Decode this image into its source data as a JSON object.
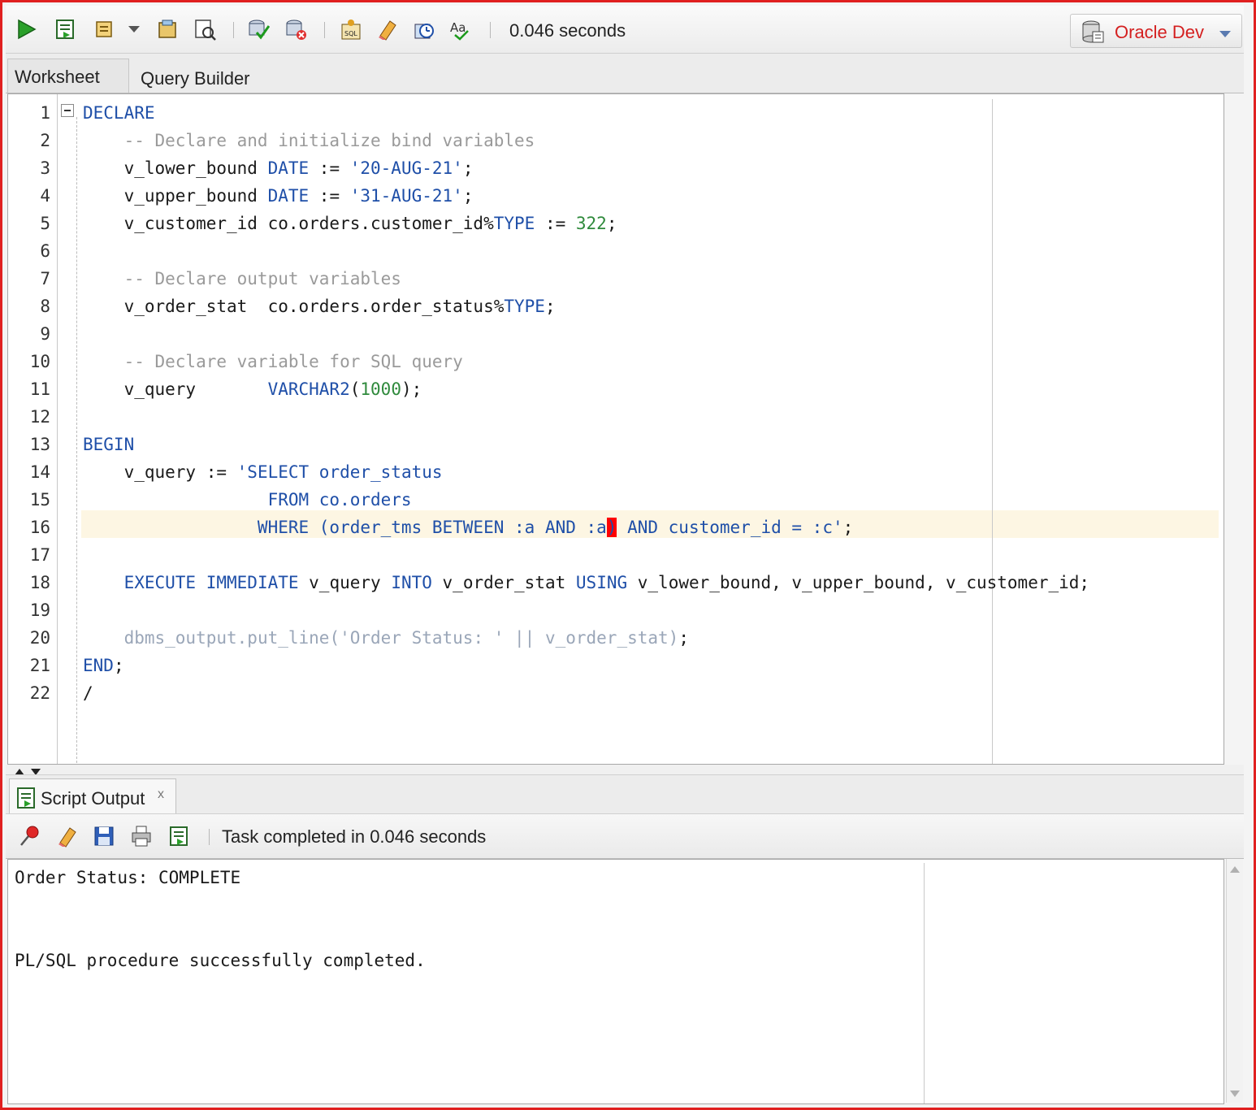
{
  "toolbar": {
    "icons": [
      "run-statement-icon",
      "run-script-icon",
      "commit-icon",
      "dropdown-arrow-icon",
      "autotrace-icon",
      "explain-plan-icon",
      "commit-changes-icon",
      "rollback-icon",
      "sql-tuning-icon",
      "clear-icon",
      "history-icon",
      "format-case-icon"
    ],
    "elapsed": "0.046 seconds",
    "connection": "Oracle Dev"
  },
  "tabs": {
    "worksheet": "Worksheet",
    "query_builder": "Query Builder"
  },
  "editor": {
    "line_numbers": [
      "1",
      "2",
      "3",
      "4",
      "5",
      "6",
      "7",
      "8",
      "9",
      "10",
      "11",
      "12",
      "13",
      "14",
      "15",
      "16",
      "17",
      "18",
      "19",
      "20",
      "21",
      "22"
    ],
    "lines": [
      [
        {
          "t": "DECLARE",
          "c": "kw"
        }
      ],
      [
        {
          "t": "    -- Declare and initialize bind variables",
          "c": "cm"
        }
      ],
      [
        {
          "t": "    v_lower_bound "
        },
        {
          "t": "DATE",
          "c": "kw"
        },
        {
          "t": " := "
        },
        {
          "t": "'20-AUG-21'",
          "c": "st"
        },
        {
          "t": ";"
        }
      ],
      [
        {
          "t": "    v_upper_bound "
        },
        {
          "t": "DATE",
          "c": "kw"
        },
        {
          "t": " := "
        },
        {
          "t": "'31-AUG-21'",
          "c": "st"
        },
        {
          "t": ";"
        }
      ],
      [
        {
          "t": "    v_customer_id co.orders.customer_id%"
        },
        {
          "t": "TYPE",
          "c": "kw"
        },
        {
          "t": " := "
        },
        {
          "t": "322",
          "c": "nm"
        },
        {
          "t": ";"
        }
      ],
      [],
      [
        {
          "t": "    -- Declare output variables",
          "c": "cm"
        }
      ],
      [
        {
          "t": "    v_order_stat  co.orders.order_status%"
        },
        {
          "t": "TYPE",
          "c": "kw"
        },
        {
          "t": ";"
        }
      ],
      [],
      [
        {
          "t": "    -- Declare variable for SQL query",
          "c": "cm"
        }
      ],
      [
        {
          "t": "    v_query       "
        },
        {
          "t": "VARCHAR2",
          "c": "kw"
        },
        {
          "t": "("
        },
        {
          "t": "1000",
          "c": "nm"
        },
        {
          "t": ");"
        }
      ],
      [],
      [
        {
          "t": "BEGIN",
          "c": "kw"
        }
      ],
      [
        {
          "t": "    v_query := "
        },
        {
          "t": "'SELECT order_status",
          "c": "st"
        }
      ],
      [
        {
          "t": "                  FROM co.orders",
          "c": "st"
        }
      ],
      [
        {
          "t": "                 WHERE (order_tms BETWEEN :a AND :a",
          "c": "st"
        },
        {
          "t": ")",
          "c": "caret"
        },
        {
          "t": " AND customer_id = :c'",
          "c": "st"
        },
        {
          "t": ";"
        }
      ],
      [],
      [
        {
          "t": "    "
        },
        {
          "t": "EXECUTE IMMEDIATE",
          "c": "kw"
        },
        {
          "t": " v_query "
        },
        {
          "t": "INTO",
          "c": "kw"
        },
        {
          "t": " v_order_stat "
        },
        {
          "t": "USING",
          "c": "kw"
        },
        {
          "t": " v_lower_bound, v_upper_bound, v_customer_id;"
        }
      ],
      [],
      [
        {
          "t": "    "
        },
        {
          "t": "dbms_output.put_line('Order Status: ' || v_order_stat)",
          "c": "fn"
        },
        {
          "t": ";"
        }
      ],
      [
        {
          "t": "END",
          "c": "kw"
        },
        {
          "t": ";"
        }
      ],
      [
        {
          "t": "/"
        }
      ]
    ]
  },
  "output": {
    "tab_label": "Script Output",
    "close_label": "x",
    "status": "Task completed in 0.046 seconds",
    "lines": [
      "Order Status: COMPLETE",
      "",
      "",
      "PL/SQL procedure successfully completed."
    ]
  }
}
